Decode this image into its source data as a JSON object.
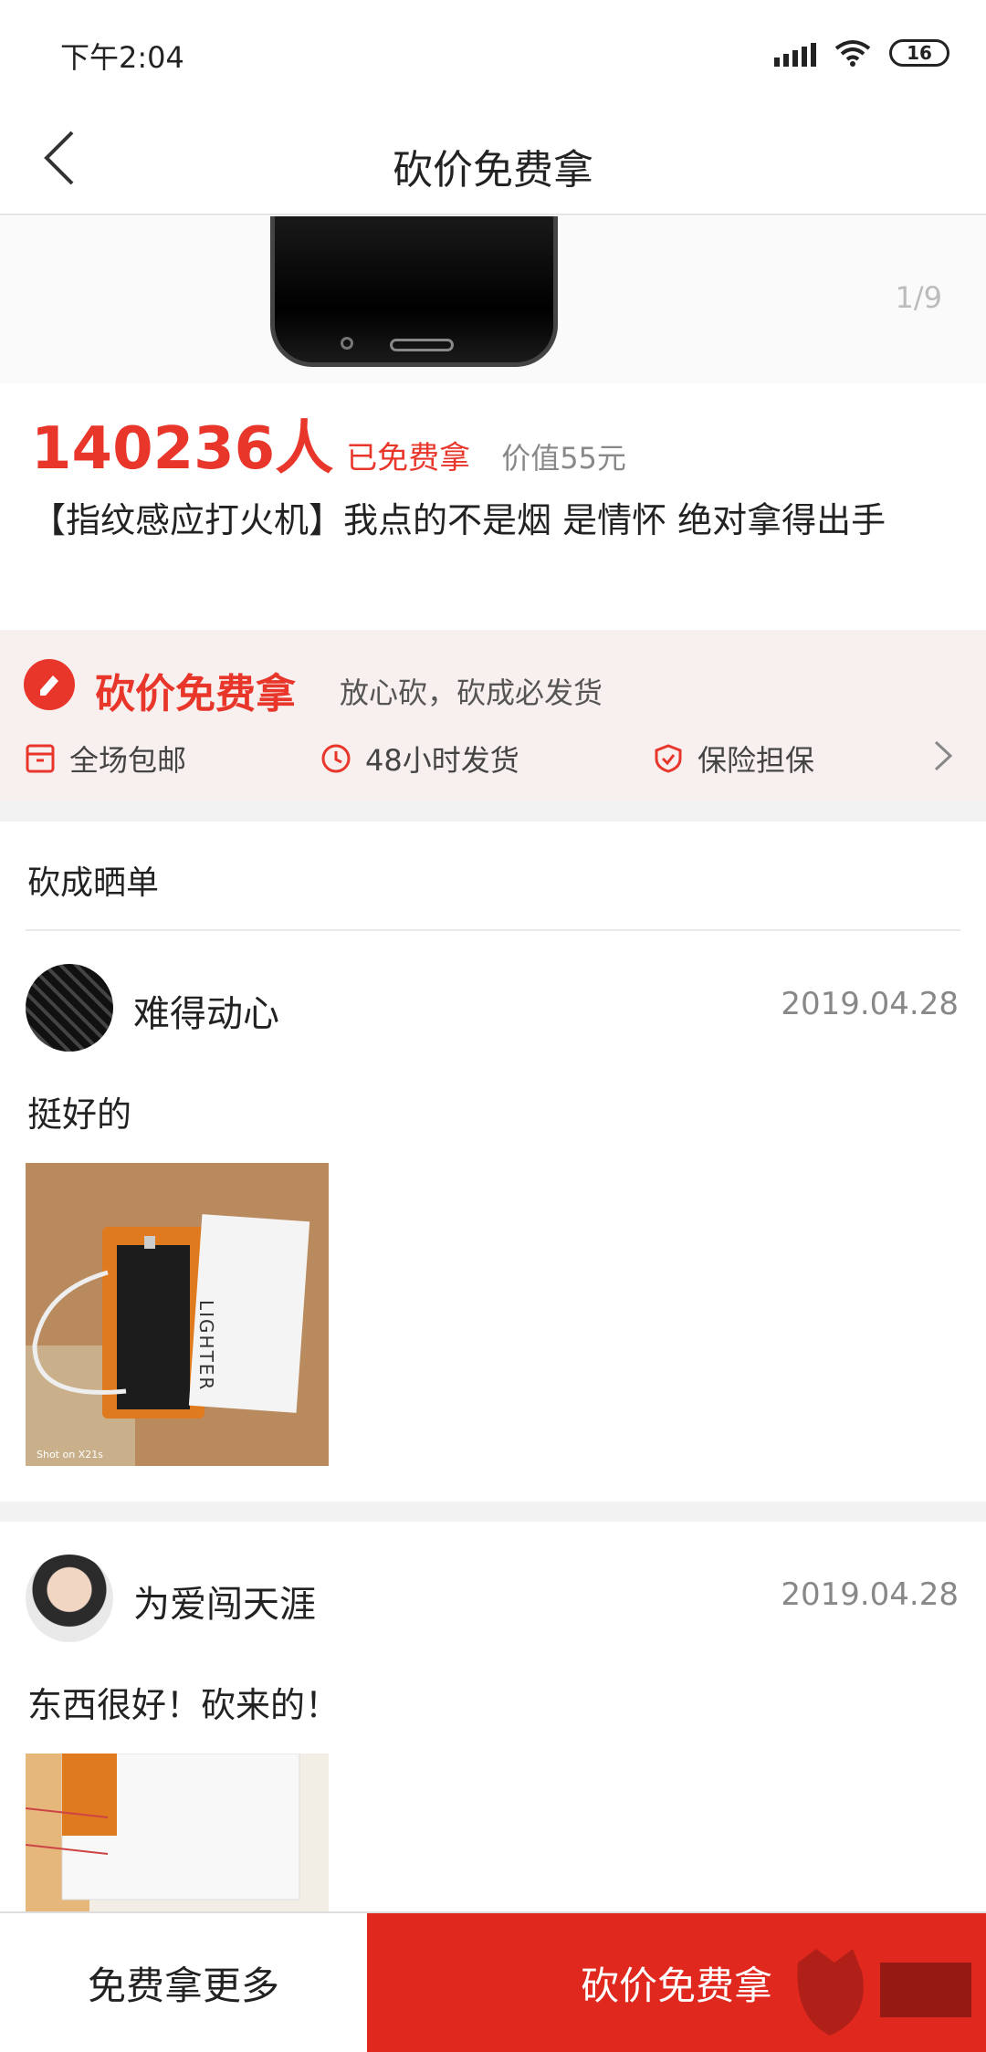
{
  "status_bar": {
    "time": "下午2:04",
    "battery": "16"
  },
  "nav": {
    "title": "砍价免费拿"
  },
  "gallery": {
    "page_indicator": "1/9"
  },
  "product": {
    "claimed_count": "140236人",
    "claimed_label": "已免费拿",
    "worth": "价值55元",
    "title": "【指纹感应打火机】我点的不是烟 是情怀 绝对拿得出手"
  },
  "promo": {
    "title": "砍价免费拿",
    "subtitle": "放心砍，砍成必发货",
    "guarantees": [
      {
        "label": "全场包邮",
        "icon": "package-icon"
      },
      {
        "label": "48小时发货",
        "icon": "clock-icon"
      },
      {
        "label": "保险担保",
        "icon": "shield-icon"
      }
    ]
  },
  "reviews": {
    "title": "砍成晒单",
    "items": [
      {
        "user": "难得动心",
        "date": "2019.04.28",
        "text": "挺好的"
      },
      {
        "user": "为爱闯天涯",
        "date": "2019.04.28",
        "text": "东西很好！砍来的！"
      }
    ]
  },
  "photo_text": {
    "box_label": "LIGHTER",
    "camera_note": "Shot on X21s"
  },
  "bottom": {
    "more_label": "免费拿更多",
    "bargain_label": "砍价免费拿"
  },
  "colors": {
    "accent": "#e8362b",
    "bargain_button": "#e0281e"
  }
}
